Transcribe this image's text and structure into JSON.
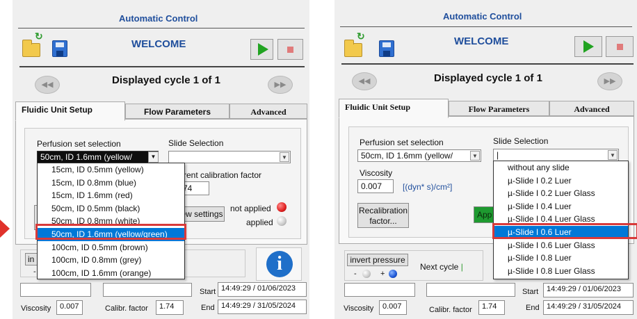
{
  "header": {
    "title": "Automatic Control",
    "welcome": "WELCOME"
  },
  "cycle": {
    "text": "Displayed cycle 1 of 1",
    "prev_glyph": "◀◀",
    "next_glyph": "▶▶"
  },
  "tabs": [
    "Fluidic Unit Setup",
    "Flow Parameters",
    "Advanced"
  ],
  "setup": {
    "perfusion_label": "Perfusion set selection",
    "slide_label": "Slide Selection",
    "perfusion_value_left": "50cm, ID 1.6mm (yellow/",
    "perfusion_value_right": "50cm, ID 1.6mm (yellow/",
    "slide_value_left": "",
    "slide_value_right": "|",
    "calibration_label": "rrent calibration factor",
    "calibration_value": "74",
    "viscosity_label": "Viscosity",
    "viscosity_value": "0.007",
    "viscosity_unit": "[(dyn* s)/cm²]",
    "view_settings": "ew settings",
    "not_applied": "not applied",
    "applied": "applied",
    "recal_btn_line1": "Recalibration",
    "recal_btn_line2": "factor...",
    "apply_btn": "App"
  },
  "perfusion_options": [
    "15cm, ID 0.5mm (yellow)",
    "15cm, ID 0.8mm (blue)",
    "15cm, ID 1.6mm (red)",
    "50cm, ID 0.5mm (black)",
    "50cm, ID 0.8mm (white)",
    "50cm, ID 1.6mm (yellow/green)",
    "100cm, ID 0.5mm (brown)",
    "100cm, ID 0.8mm (grey)",
    "100cm, ID 1.6mm (orange)"
  ],
  "slide_options": [
    "without any slide",
    "µ-Slide I 0.2 Luer",
    "µ-Slide I 0.2 Luer Glass",
    "µ-Slide I 0.4 Luer",
    "µ-Slide I 0.4 Luer Glass",
    "µ-Slide I 0.6 Luer",
    "µ-Slide I 0.6 Luer Glass",
    "µ-Slide I 0.8 Luer",
    "µ-Slide I 0.8 Luer Glass"
  ],
  "bottom": {
    "invert_left": "in",
    "invert_right": "invert pressure",
    "minus": "-",
    "plus": "+",
    "next_cycle": "Next cycle",
    "start_label": "Start",
    "start_value": "14:49:29 / 01/06/2023",
    "end_label": "End",
    "end_value": "14:49:29 / 31/05/2024",
    "viscosity_label": "Viscosity",
    "viscosity_value": "0.007",
    "calib_label": "Calibr. factor",
    "calib_value": "1.74",
    "info_glyph": "i"
  },
  "colors": {
    "selection": "#0078d7",
    "highlight_box": "#d83a3a",
    "title_blue": "#1f4e9c",
    "led_red": "#e02020",
    "led_grey": "#c9c9c9",
    "play_green": "#21a321"
  }
}
